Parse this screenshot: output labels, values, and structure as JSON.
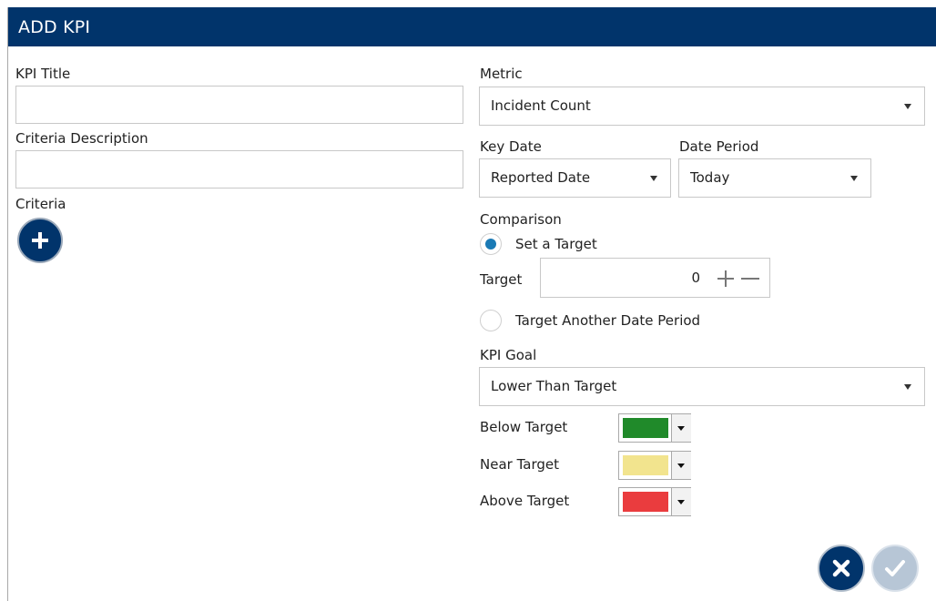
{
  "dialog": {
    "title": "ADD KPI"
  },
  "left": {
    "kpi_title_label": "KPI Title",
    "kpi_title_value": "",
    "criteria_description_label": "Criteria Description",
    "criteria_description_value": "",
    "criteria_label": "Criteria",
    "add_icon": "plus-icon"
  },
  "right": {
    "metric_label": "Metric",
    "metric_value": "Incident Count",
    "key_date_label": "Key Date",
    "key_date_value": "Reported Date",
    "date_period_label": "Date Period",
    "date_period_value": "Today",
    "comparison_label": "Comparison",
    "set_target_label": "Set a Target",
    "set_target_checked": true,
    "target_label": "Target",
    "target_value": "0",
    "target_another_label": "Target Another Date Period",
    "target_another_checked": false,
    "kpi_goal_label": "KPI Goal",
    "kpi_goal_value": "Lower Than Target",
    "thresholds": [
      {
        "label": "Below Target",
        "color": "#208a2a"
      },
      {
        "label": "Near Target",
        "color": "#f2e48e"
      },
      {
        "label": "Above Target",
        "color": "#ea3c3e"
      }
    ]
  },
  "footer": {
    "cancel_icon": "close-icon",
    "confirm_icon": "check-icon"
  },
  "colors": {
    "brand": "#01346b",
    "radio_accent": "#1a7ab5",
    "disabled_confirm": "#b7c6d6"
  }
}
